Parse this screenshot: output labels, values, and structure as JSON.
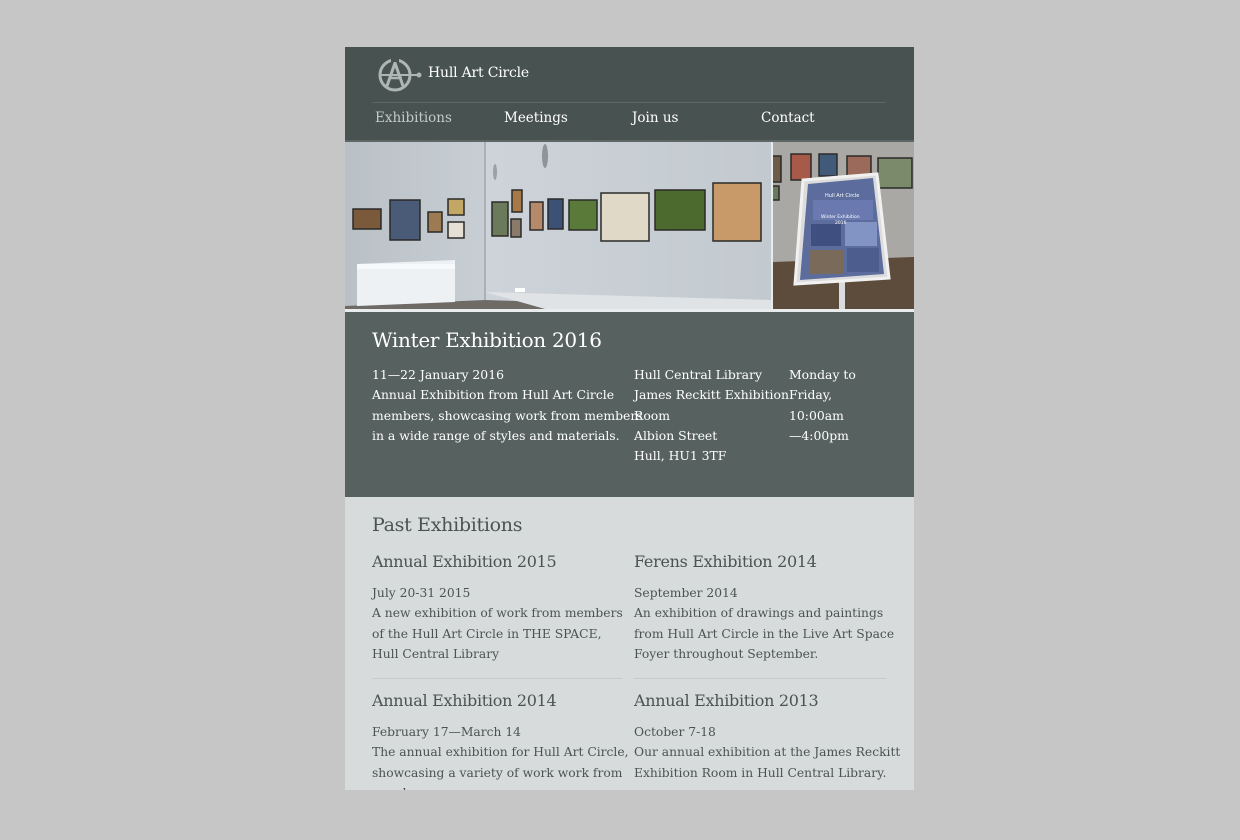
{
  "site": {
    "title": "Hull Art Circle",
    "colors": {
      "header": "#485251",
      "current_panel": "#566160",
      "content_bg": "#d7dbdc",
      "page_bg": "#c6c6c6"
    }
  },
  "nav": {
    "items": [
      {
        "label": "Exhibitions",
        "active": true
      },
      {
        "label": "Meetings",
        "active": false
      },
      {
        "label": "Join us",
        "active": false
      },
      {
        "label": "Contact",
        "active": false
      }
    ]
  },
  "current": {
    "title": "Winter Exhibition 2016",
    "lines": [
      "11—22 January 2016",
      "Annual Exhibition from Hull Art Circle",
      "members, showcasing work from members",
      "in a wide range of styles and materials."
    ],
    "venue": [
      "Hull Central Library",
      "James Reckitt Exhibition",
      "Room",
      "Albion Street",
      "Hull, HU1 3TF"
    ],
    "hours": [
      "Monday to",
      "Friday,",
      "10:00am",
      "—4:00pm"
    ],
    "poster": {
      "heading": "Hull Art Circle",
      "line1": "Winter Exhibition",
      "line2": "2016"
    }
  },
  "past": {
    "heading": "Past Exhibitions",
    "items": [
      {
        "title": "Annual Exhibition 2015",
        "date": "July 20-31 2015",
        "desc": [
          "A new exhibition of work from members",
          "of the Hull Art Circle in THE SPACE,",
          "Hull Central Library"
        ]
      },
      {
        "title": "Ferens Exhibition 2014",
        "date": "September 2014",
        "desc": [
          "An exhibition of drawings and paintings",
          "from Hull Art Circle in the Live Art Space",
          "Foyer throughout September."
        ]
      },
      {
        "title": "Annual Exhibition 2014",
        "date": "February 17—March 14",
        "desc": [
          "The annual exhibition for Hull Art Circle,",
          "showcasing a variety of work work from",
          "members"
        ]
      },
      {
        "title": "Annual Exhibition 2013",
        "date": "October 7-18",
        "desc": [
          "Our annual exhibition at the James Reckitt",
          "Exhibition Room in Hull Central Library."
        ]
      }
    ]
  }
}
